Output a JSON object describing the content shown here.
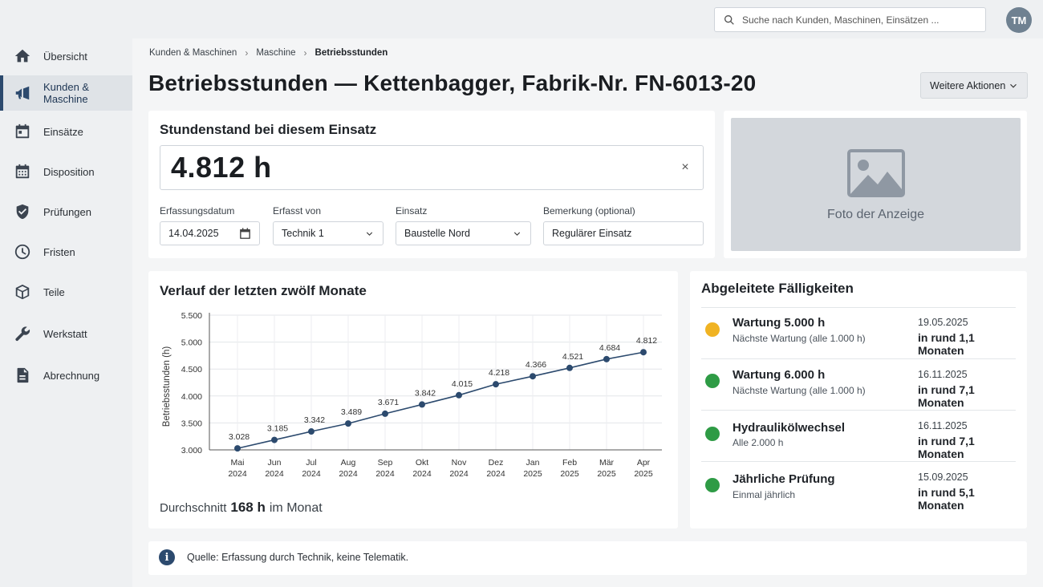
{
  "sidebar": {
    "items": [
      {
        "label": "Übersicht",
        "icon": "home-icon"
      },
      {
        "label": "Kunden & Maschine",
        "icon": "megaphone-icon",
        "active": true
      },
      {
        "label": "Einsätze",
        "icon": "calendar-icon"
      },
      {
        "label": "Disposition",
        "icon": "calendar-grid-icon"
      },
      {
        "label": "Prüfungen",
        "icon": "shield-check-icon"
      },
      {
        "label": "Fristen",
        "icon": "clock-icon"
      },
      {
        "label": "Teile",
        "icon": "box-icon"
      },
      {
        "label": "Werkstatt",
        "icon": "wrench-icon"
      },
      {
        "label": "Abrechnung",
        "icon": "document-icon"
      }
    ]
  },
  "header": {
    "search_placeholder": "Suche nach Kunden, Maschinen, Einsätzen ...",
    "avatar_initials": "TM"
  },
  "breadcrumb": {
    "items": [
      "Kunden & Maschinen",
      "Maschine",
      "Betriebsstunden"
    ]
  },
  "page": {
    "title": "Betriebsstunden — Kettenbagger, Fabrik-Nr. FN-6013-20",
    "more_actions": "Weitere Aktionen"
  },
  "hours_card": {
    "title": "Stundenstand bei diesem Einsatz",
    "value": "4.812 h",
    "clear_symbol": "×",
    "fields": {
      "date_label": "Erfassungsdatum",
      "date_value": "14.04.2025",
      "by_label": "Erfasst von",
      "by_value": "Technik 1",
      "job_label": "Einsatz",
      "job_value": "Baustelle Nord",
      "note_label": "Bemerkung (optional)",
      "note_value": "Regulärer Einsatz"
    }
  },
  "photo": {
    "label": "Foto der Anzeige"
  },
  "chart_card": {
    "title": "Verlauf der letzten zwölf Monate",
    "avg_prefix": "Durchschnitt",
    "avg_value": "168 h",
    "avg_suffix": "im Monat"
  },
  "chart_data": {
    "type": "line",
    "title": "Verlauf der letzten zwölf Monate",
    "xlabel": "",
    "ylabel": "Betriebsstunden (h)",
    "categories": [
      "Mai 2024",
      "Jun 2024",
      "Jul 2024",
      "Aug 2024",
      "Sep 2024",
      "Okt 2024",
      "Nov 2024",
      "Dez 2024",
      "Jan 2025",
      "Feb 2025",
      "Mär 2025",
      "Apr 2025"
    ],
    "category_lines": [
      [
        "Mai",
        "2024"
      ],
      [
        "Jun",
        "2024"
      ],
      [
        "Jul",
        "2024"
      ],
      [
        "Aug",
        "2024"
      ],
      [
        "Sep",
        "2024"
      ],
      [
        "Okt",
        "2024"
      ],
      [
        "Nov",
        "2024"
      ],
      [
        "Dez",
        "2024"
      ],
      [
        "Jan",
        "2025"
      ],
      [
        "Feb",
        "2025"
      ],
      [
        "Mär",
        "2025"
      ],
      [
        "Apr",
        "2025"
      ]
    ],
    "values": [
      3028,
      3185,
      3342,
      3489,
      3671,
      3842,
      4015,
      4218,
      4366,
      4521,
      4684,
      4812
    ],
    "value_labels": [
      "3.028",
      "3.185",
      "3.342",
      "3.489",
      "3.671",
      "3.842",
      "4.015",
      "4.218",
      "4.366",
      "4.521",
      "4.684",
      "4.812"
    ],
    "ylim": [
      3000,
      5500
    ],
    "yticks": [
      3000,
      3500,
      4000,
      4500,
      5000,
      5500
    ],
    "ytick_labels": [
      "3.000",
      "3.500",
      "4.000",
      "4.500",
      "5.000",
      "5.500"
    ],
    "grid": true,
    "color": "#2c4a6e"
  },
  "due_card": {
    "title": "Abgeleitete Fälligkeiten",
    "items": [
      {
        "name": "Wartung 5.000 h",
        "sub": "Nächste Wartung (alle 1.000 h)",
        "date": "19.05.2025",
        "relative": "in rund 1,1 Monaten",
        "status_color": "#f0b323"
      },
      {
        "name": "Wartung 6.000 h",
        "sub": "Nächste Wartung (alle 1.000 h)",
        "date": "16.11.2025",
        "relative": "in rund 7,1 Monaten",
        "status_color": "#2e9b45"
      },
      {
        "name": "Hydraulikölwechsel",
        "sub": "Alle 2.000 h",
        "date": "16.11.2025",
        "relative": "in rund 7,1 Monaten",
        "status_color": "#2e9b45"
      },
      {
        "name": "Jährliche Prüfung",
        "sub": "Einmal jährlich",
        "date": "15.09.2025",
        "relative": "in rund 5,1 Monaten",
        "status_color": "#2e9b45"
      }
    ]
  },
  "source": {
    "icon": "info-icon",
    "text": "Quelle: Erfassung durch Technik, keine Telematik."
  }
}
